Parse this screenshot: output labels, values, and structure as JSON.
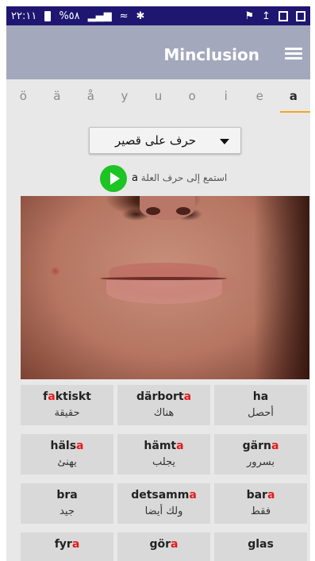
{
  "status_bar": {
    "time": "٢٢:١١",
    "battery_text": "%٥٨"
  },
  "app": {
    "title": "Minclusion"
  },
  "tabs": [
    "ö",
    "ä",
    "å",
    "y",
    "u",
    "o",
    "i",
    "e",
    "a"
  ],
  "active_tab": "a",
  "dropdown": {
    "selected": "حرف على قصير"
  },
  "listen": {
    "label": "استمع إلى حرف العلة",
    "vowel": "a"
  },
  "colors": {
    "accent": "#f5a51c",
    "play": "#1ec324",
    "highlight": "#e31c1c",
    "appbar": "#a3a8bc",
    "statusbar": "#1e1670"
  },
  "words": [
    {
      "pre": "f",
      "hl": "a",
      "post": "ktiskt",
      "translation": "حقيقة"
    },
    {
      "pre": "därbort",
      "hl": "a",
      "post": "",
      "translation": "هناك"
    },
    {
      "pre": "ha",
      "hl": "",
      "post": "",
      "translation": "أحصل"
    },
    {
      "pre": "häls",
      "hl": "a",
      "post": "",
      "translation": "يهنئ"
    },
    {
      "pre": "hämt",
      "hl": "a",
      "post": "",
      "translation": "يجلب"
    },
    {
      "pre": "gärn",
      "hl": "a",
      "post": "",
      "translation": "بسرور"
    },
    {
      "pre": "bra",
      "hl": "",
      "post": "",
      "translation": "جيد"
    },
    {
      "pre": "detsamm",
      "hl": "a",
      "post": "",
      "translation": "ولك أيضا"
    },
    {
      "pre": "bar",
      "hl": "a",
      "post": "",
      "translation": "فقط"
    },
    {
      "pre": "fyr",
      "hl": "a",
      "post": "",
      "translation": ""
    },
    {
      "pre": "gör",
      "hl": "a",
      "post": "",
      "translation": ""
    },
    {
      "pre": "glas",
      "hl": "",
      "post": "",
      "translation": ""
    }
  ]
}
